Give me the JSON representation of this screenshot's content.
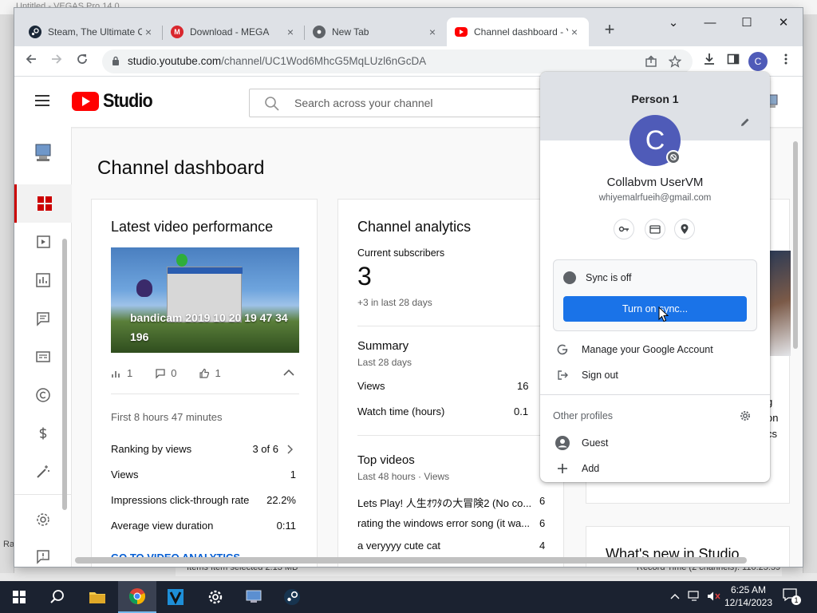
{
  "background_app": {
    "title": "Untitled - VEGAS Pro 14.0",
    "status_items": "Items    Item selected  2.13 MB",
    "record_time": "Record Time (2 channels): 110:25:59",
    "left_label": "Ra"
  },
  "browser": {
    "tabs": [
      {
        "label": "Steam, The Ultimate Online Game Platform",
        "icon": "steam-icon",
        "color": "#1b2838",
        "close": "×"
      },
      {
        "label": "Download - MEGA",
        "icon": "mega-icon",
        "color": "#d9272e",
        "close": "×"
      },
      {
        "label": "New Tab",
        "icon": "chrome-icon",
        "color": "#5f6368",
        "close": "×"
      },
      {
        "label": "Channel dashboard - YouTube Studio",
        "icon": "youtube-icon",
        "color": "#ff0000",
        "close": "×"
      }
    ],
    "new_tab": "+",
    "window_controls": {
      "dropdown": "⌄",
      "minimize": "—",
      "maximize": "☐",
      "close": "✕"
    },
    "url_host": "studio.youtube.com",
    "url_path": "/channel/UC1Wod6MhcG5MqLUzl6nGcDA",
    "profile_initial": "C"
  },
  "studio": {
    "logo_text": "Studio",
    "search_placeholder": "Search across your channel",
    "page_title": "Channel dashboard",
    "latest_video": {
      "title": "Latest video performance",
      "video_title": "bandicam 2019 10 20 19 47 34 196",
      "views_icon_count": "1",
      "comments_count": "0",
      "likes_count": "1",
      "period": "First 8 hours 47 minutes",
      "rows": [
        {
          "label": "Ranking by views",
          "value": "3 of 6"
        },
        {
          "label": "Views",
          "value": "1"
        },
        {
          "label": "Impressions click-through rate",
          "value": "22.2%"
        },
        {
          "label": "Average view duration",
          "value": "0:11"
        }
      ],
      "link": "GO TO VIDEO ANALYTICS"
    },
    "analytics": {
      "title": "Channel analytics",
      "subs_label": "Current subscribers",
      "subs_value": "3",
      "subs_delta": "+3 in last 28 days",
      "summary_title": "Summary",
      "summary_period": "Last 28 days",
      "summary_rows": [
        {
          "label": "Views",
          "value": "16"
        },
        {
          "label": "Watch time (hours)",
          "value": "0.1"
        }
      ],
      "top_title": "Top videos",
      "top_period": "Last 48 hours · Views",
      "top_rows": [
        {
          "label": "Lets Play! 人生ｵﾜﾀの大冒険2 (No co...",
          "value": "6"
        },
        {
          "label": "rating the windows error song (it wa...",
          "value": "6"
        },
        {
          "label": "a veryyyy cute cat",
          "value": "4"
        }
      ]
    },
    "right_snippets": [
      "g",
      "on",
      "cs"
    ],
    "whats_new": "What's new in Studio"
  },
  "profile_menu": {
    "header": "Person 1",
    "initial": "C",
    "name": "Collabvm UserVM",
    "email": "whiyemalrfueih@gmail.com",
    "sync_status": "Sync is off",
    "sync_button": "Turn on sync...",
    "manage_account": "Manage your Google Account",
    "sign_out": "Sign out",
    "other_profiles": "Other profiles",
    "guest": "Guest",
    "add": "Add"
  },
  "taskbar": {
    "time": "6:25 AM",
    "date": "12/14/2023",
    "notif_count": "1"
  }
}
